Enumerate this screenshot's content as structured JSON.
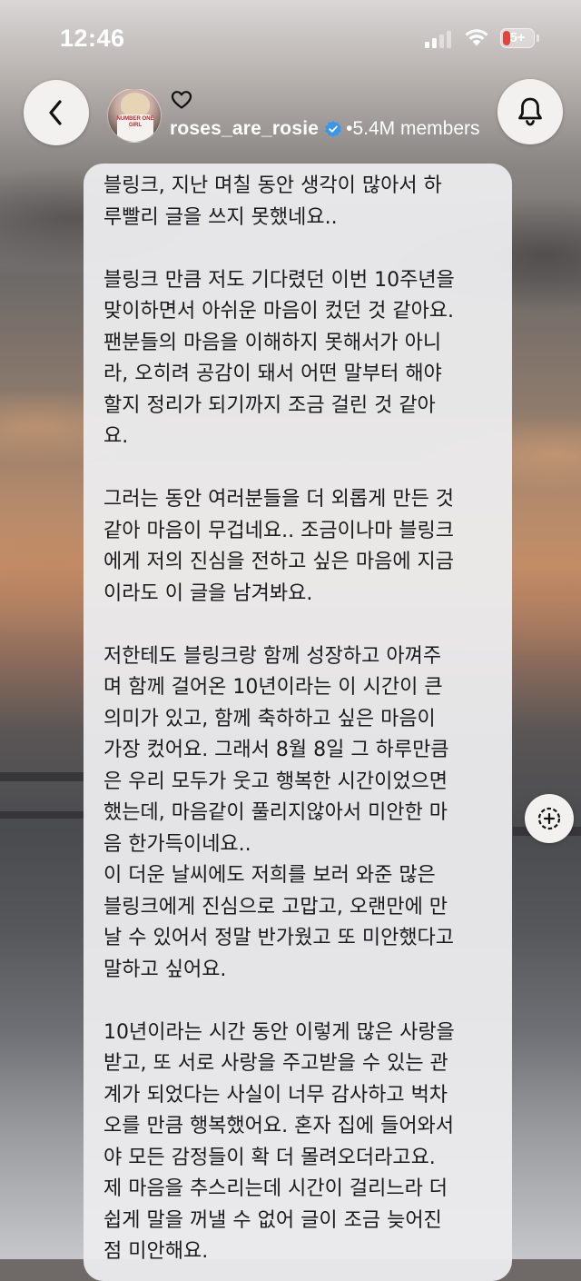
{
  "status_bar": {
    "time": "12:46",
    "battery_label": "5+",
    "battery_color": "#e0443e"
  },
  "header": {
    "back_icon": "chevron-left-icon",
    "channel_name": "roses_are_rosie",
    "separator": "•",
    "member_count": "5.4M members",
    "heart_icon": "heart-icon",
    "verified_icon": "verified-badge-icon",
    "bell_icon": "bell-icon",
    "avatar_text": "NUMBER ONE GIRL"
  },
  "message": {
    "paragraphs": [
      "블링크, 지난 며칠 동안 생각이 많아서 하\n루빨리 글을 쓰지 못했네요..",
      "블링크 만큼 저도 기다렸던 이번 10주년을\n맞이하면서 아쉬운 마음이 컸던 것 같아요.\n팬분들의 마음을 이해하지 못해서가 아니\n라, 오히려 공감이 돼서 어떤 말부터 해야\n할지 정리가 되기까지 조금 걸린 것 같아\n요.",
      "그러는 동안 여러분들을 더 외롭게 만든 것\n같아 마음이 무겁네요.. 조금이나마 블링크\n에게 저의 진심을 전하고 싶은 마음에 지금\n이라도 이 글을 남겨봐요.",
      "저한테도 블링크랑 함께 성장하고 아껴주\n며 함께 걸어온 10년이라는 이 시간이 큰\n의미가 있고, 함께 축하하고 싶은 마음이\n가장 컸어요. 그래서 8월 8일 그 하루만큼\n은 우리 모두가 웃고 행복한 시간이었으면\n했는데, 마음같이 풀리지않아서 미안한 마\n음 한가득이네요..",
      "이 더운 날씨에도 저희를 보러 와준 많은\n블링크에게 진심으로 고맙고, 오랜만에 만\n날 수 있어서 정말 반가웠고 또 미안했다고\n말하고 싶어요.",
      "10년이라는 시간 동안 이렇게 많은 사랑을\n받고, 또 서로 사랑을 주고받을 수 있는 관\n계가 되었다는 사실이 너무 감사하고 벅차\n오를 만큼 행복했어요. 혼자 집에 들어와서\n야 모든 감정들이 확 더 몰려오더라고요.\n제 마음을 추스리는데 시간이 걸리느라 더\n쉽게 말을 꺼낼 수 없어 글이 조금 늦어진\n점 미안해요."
    ]
  },
  "floating": {
    "quote_icon": "add-reaction-icon"
  }
}
